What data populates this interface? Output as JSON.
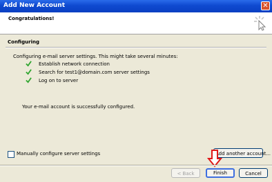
{
  "window": {
    "title": "Add New Account"
  },
  "header": {
    "title": "Congratulations!"
  },
  "section": {
    "title": "Configuring",
    "intro": "Configuring e-mail server settings. This might take several minutes:",
    "steps": [
      {
        "label": "Establish network connection"
      },
      {
        "label": "Search for test1@domain.com server settings"
      },
      {
        "label": "Log on to server"
      }
    ],
    "success": "Your e-mail account is successfully configured."
  },
  "options": {
    "manual_label": "Manually configure server settings",
    "add_another_label": "Add another account..."
  },
  "buttons": {
    "back": "< Back",
    "finish": "Finish",
    "cancel": "Cancel"
  },
  "colors": {
    "check": "#2fa52f",
    "annotation_arrow": "#e01919"
  }
}
